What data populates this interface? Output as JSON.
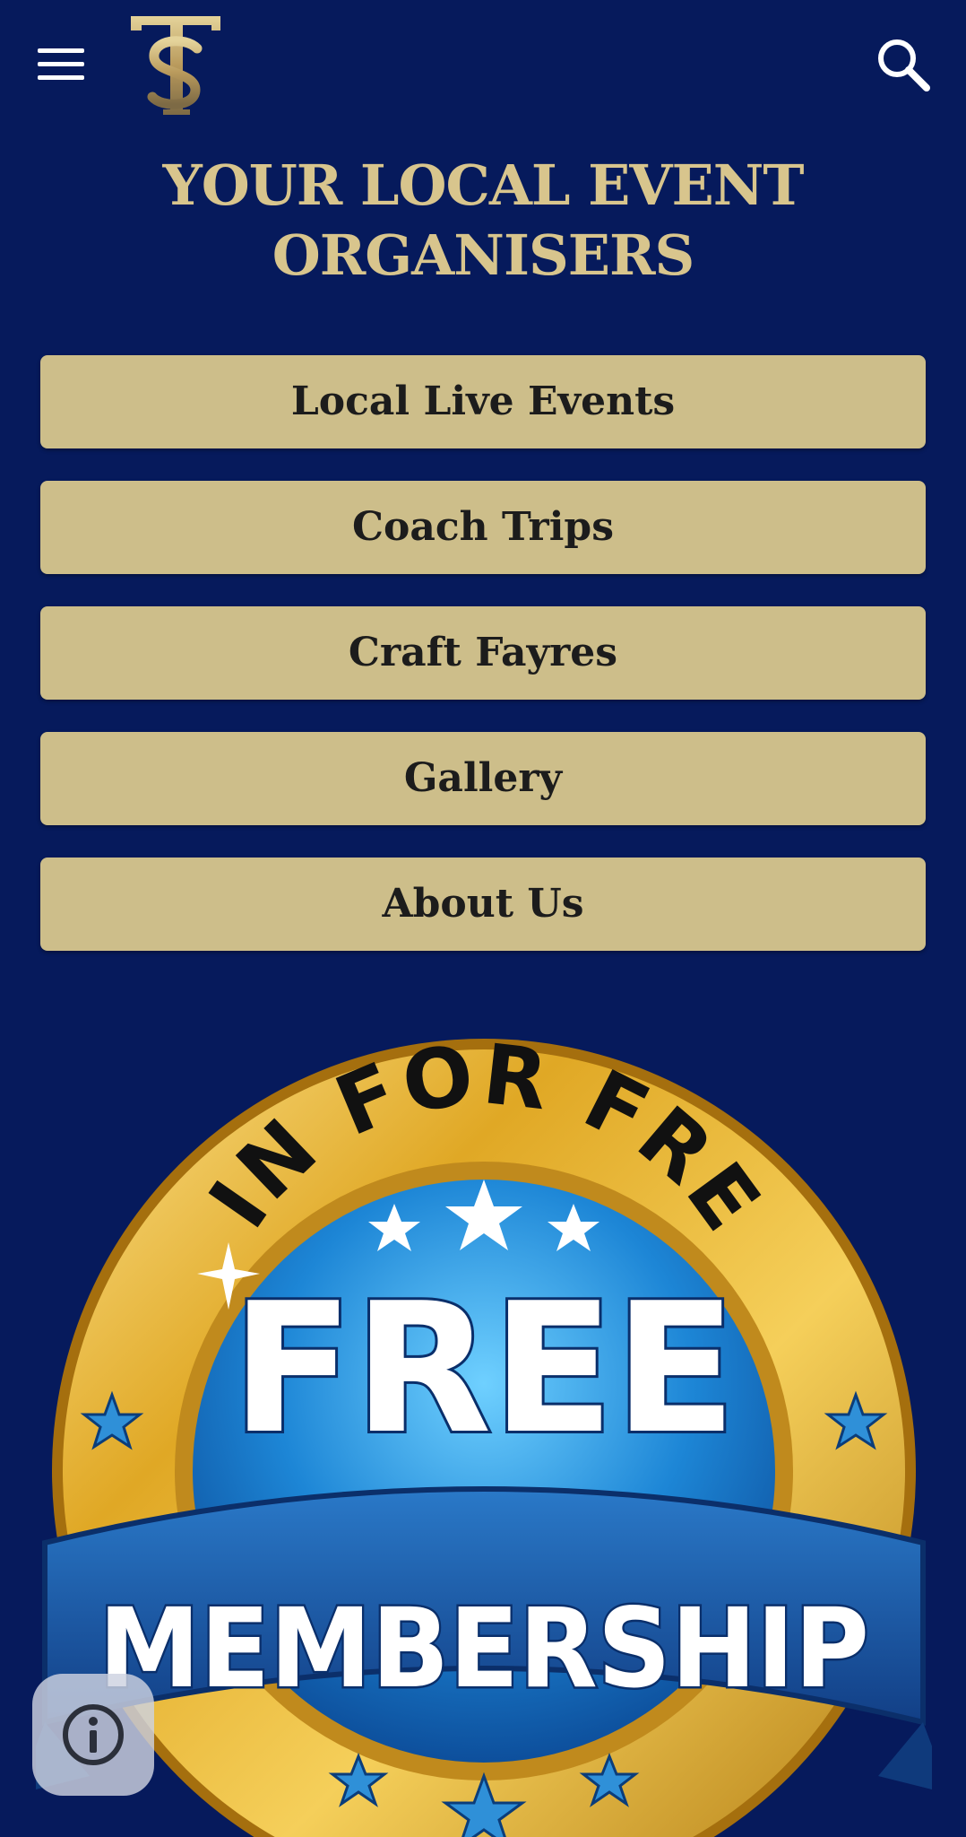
{
  "header": {
    "menu_icon": "hamburger-menu-icon",
    "logo_letters": "TS",
    "search_icon": "search-icon"
  },
  "headline": {
    "line1": "YOUR LOCAL EVENT",
    "line2": "ORGANISERS"
  },
  "nav_items": [
    {
      "label": "Local Live Events"
    },
    {
      "label": "Coach Trips"
    },
    {
      "label": "Craft Fayres"
    },
    {
      "label": "Gallery"
    },
    {
      "label": "About Us"
    }
  ],
  "promo_badge": {
    "arc_text": "JOIN FOR FREE!",
    "big_text": "FREE",
    "ribbon_text": "MEMBERSHIP"
  },
  "info_button": {
    "icon": "info-icon"
  },
  "colors": {
    "background": "#061a5c",
    "gold": "#d8c58d",
    "button_fill": "#cdbe8a",
    "button_text": "#1c1c1c"
  }
}
